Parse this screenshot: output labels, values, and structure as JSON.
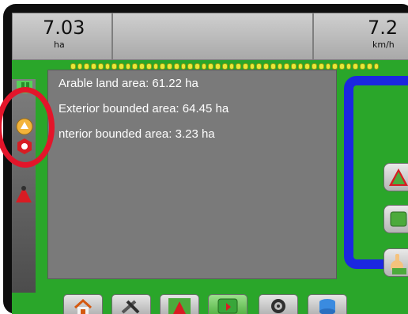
{
  "status_bar": {
    "area_value": "7.03",
    "area_unit": "ha",
    "speed_value": "7.2",
    "speed_unit": "km/h"
  },
  "area_info": {
    "arable": "Arable land area: 61.22 ha",
    "exterior": "Exterior bounded area: 64.45 ha",
    "interior": "nterior bounded area: 3.23 ha"
  },
  "icons": {
    "left_panel": [
      "guidance-mode-icon",
      "circle-arrow-icon",
      "red-heading-icon",
      "vehicle-icon"
    ],
    "right_panel": [
      "vehicle-view-icon",
      "field-view-icon",
      "hand-pan-icon"
    ],
    "bottom_bar": [
      "home-icon",
      "tools-icon",
      "vehicle-view-icon",
      "field-view-icon",
      "gps-status-icon",
      "data-icon"
    ]
  },
  "colors": {
    "field_green": "#2aa62a",
    "boundary_blue": "#1b27e0",
    "highlight_red": "#e3152a"
  }
}
